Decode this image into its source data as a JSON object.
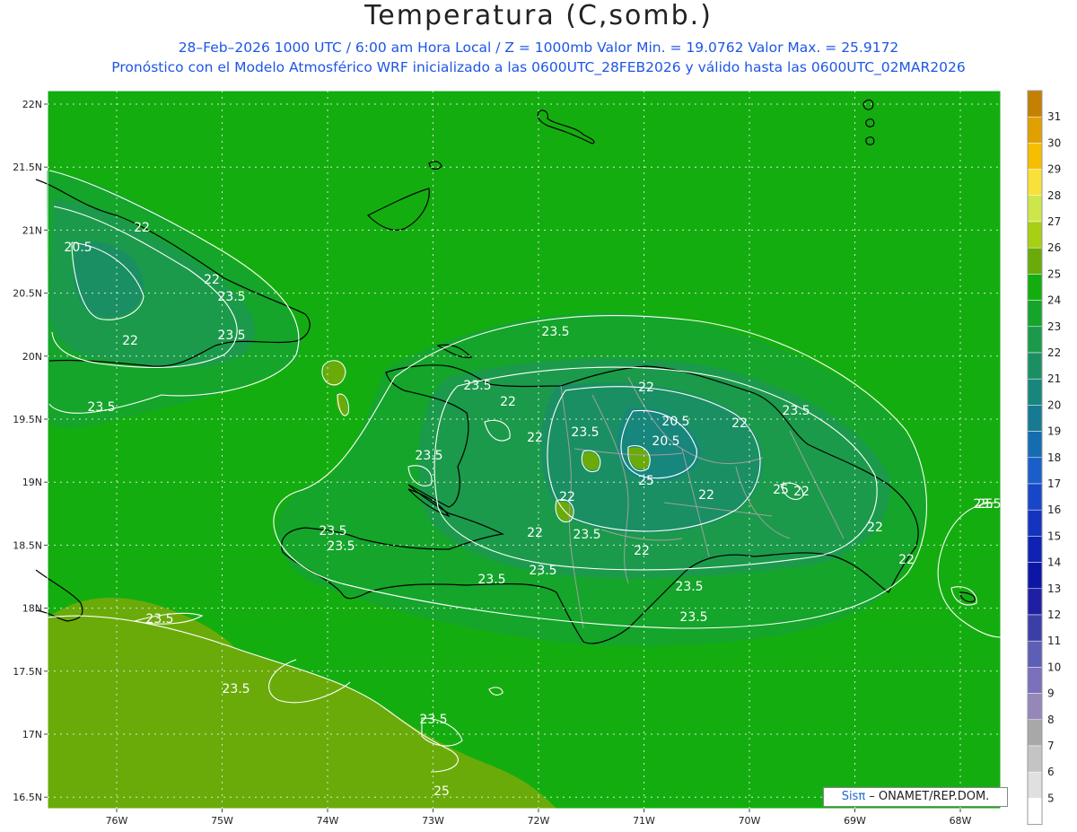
{
  "title": "Temperatura (C,somb.)",
  "subtitle_line1": "28–Feb–2026  1000 UTC / 6:00 am Hora Local / Z = 1000mb    Valor Min. = 19.0762  Valor Max. = 25.9172",
  "subtitle_line2": "Pronóstico con el Modelo Atmosférico WRF inicializado a las 0600UTC_28FEB2026 y válido hasta las  0600UTC_02MAR2026",
  "credit": {
    "brand": "Sisπ",
    "text": " – ONAMET/REP.DOM."
  },
  "lat_labels": [
    "22N",
    "21.5N",
    "21N",
    "20.5N",
    "20N",
    "19.5N",
    "19N",
    "18.5N",
    "18N",
    "17.5N",
    "17N",
    "16.5N"
  ],
  "lon_labels": [
    "76W",
    "75W",
    "74W",
    "73W",
    "72W",
    "71W",
    "70W",
    "69W",
    "68W"
  ],
  "colorbar": [
    {
      "v": "31",
      "c": "#c48000"
    },
    {
      "v": "30",
      "c": "#e0a000"
    },
    {
      "v": "29",
      "c": "#f5be00"
    },
    {
      "v": "28",
      "c": "#f8e23a"
    },
    {
      "v": "27",
      "c": "#cde64a"
    },
    {
      "v": "26",
      "c": "#a7cf14"
    },
    {
      "v": "25",
      "c": "#6aab0a"
    },
    {
      "v": "24",
      "c": "#14ad10"
    },
    {
      "v": "23",
      "c": "#14a52a"
    },
    {
      "v": "22",
      "c": "#1b9a4b"
    },
    {
      "v": "21",
      "c": "#1a8f64"
    },
    {
      "v": "20",
      "c": "#17867c"
    },
    {
      "v": "19",
      "c": "#157a92"
    },
    {
      "v": "18",
      "c": "#156cb0"
    },
    {
      "v": "17",
      "c": "#1a5ec9"
    },
    {
      "v": "16",
      "c": "#1747c8"
    },
    {
      "v": "15",
      "c": "#1434c0"
    },
    {
      "v": "14",
      "c": "#0e22b3"
    },
    {
      "v": "13",
      "c": "#0c16a6"
    },
    {
      "v": "12",
      "c": "#1f1fa3"
    },
    {
      "v": "11",
      "c": "#3c3ea8"
    },
    {
      "v": "10",
      "c": "#5d5eb5"
    },
    {
      "v": "9",
      "c": "#7a70bb"
    },
    {
      "v": "8",
      "c": "#9588b9"
    },
    {
      "v": "7",
      "c": "#a8a8a8"
    },
    {
      "v": "6",
      "c": "#c4c4c4"
    },
    {
      "v": "5",
      "c": "#e0e0e0"
    },
    {
      "v": "",
      "c": "#ffffff"
    }
  ],
  "contour_labels": [
    "22",
    "20.5",
    "23.5",
    "22",
    "22",
    "23.5",
    "23.5",
    "23.5",
    "22",
    "22",
    "22",
    "20.5",
    "20.5",
    "22",
    "23.5",
    "23.5",
    "23.5",
    "22",
    "22",
    "22",
    "22",
    "23.5",
    "23.5",
    "23.5",
    "23.5",
    "23.5",
    "23.5",
    "22",
    "22",
    "23.5",
    "23.5",
    "22",
    "23.5",
    "23.5",
    "23.5",
    "23.5",
    "25",
    "25",
    "25",
    "25"
  ],
  "colors": {
    "sea": "#14ad10",
    "warm": "#6aab0a",
    "cool1": "#1b9a4b",
    "cool2": "#1a8f64",
    "cool3": "#17867c"
  }
}
